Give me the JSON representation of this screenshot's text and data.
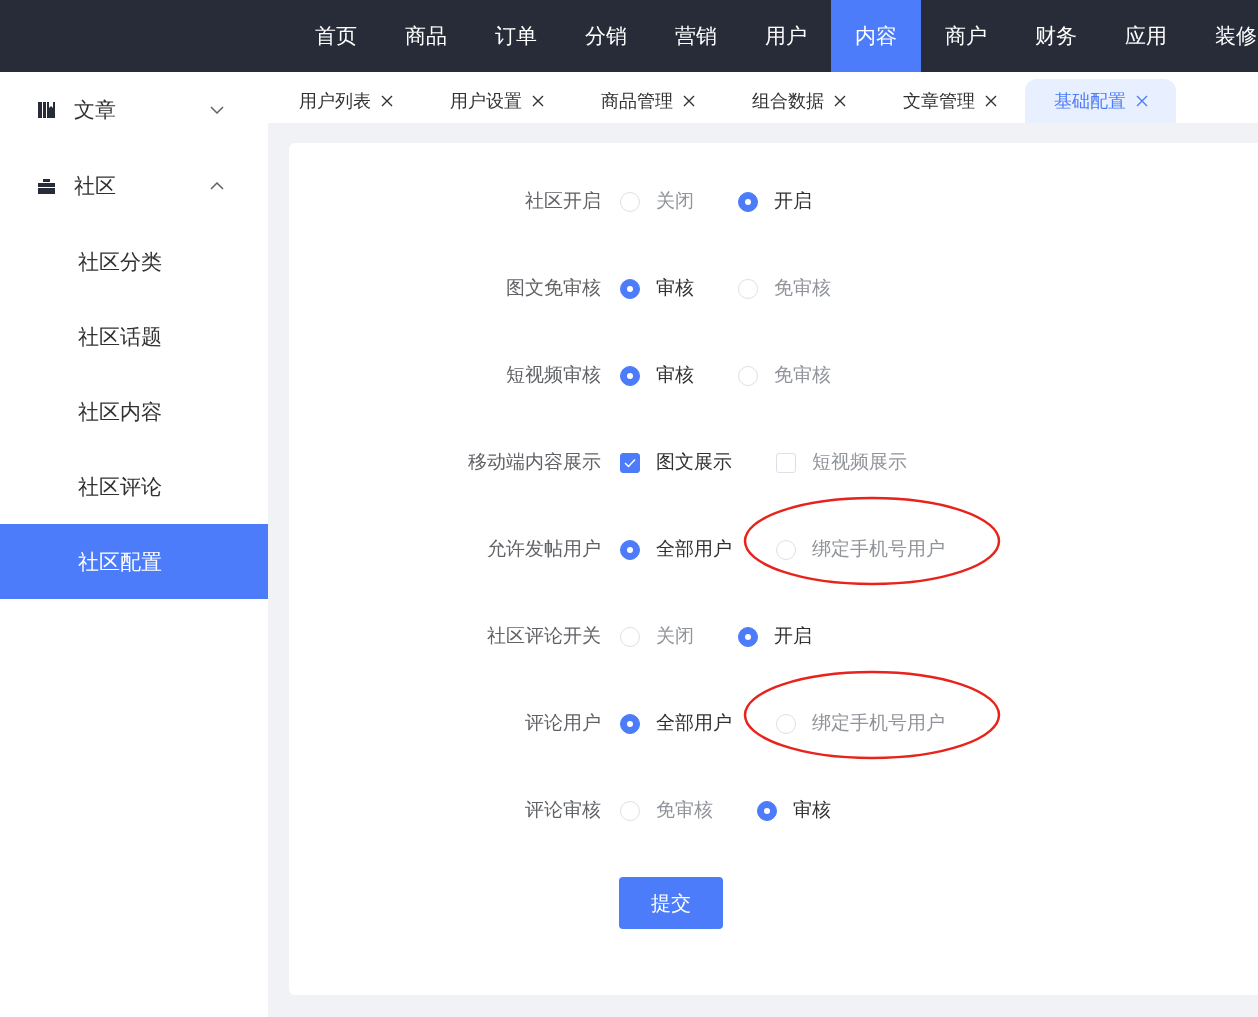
{
  "top_nav": [
    {
      "label": "首页",
      "selected": false
    },
    {
      "label": "商品",
      "selected": false
    },
    {
      "label": "订单",
      "selected": false
    },
    {
      "label": "分销",
      "selected": false
    },
    {
      "label": "营销",
      "selected": false
    },
    {
      "label": "用户",
      "selected": false
    },
    {
      "label": "内容",
      "selected": true
    },
    {
      "label": "商户",
      "selected": false
    },
    {
      "label": "财务",
      "selected": false
    },
    {
      "label": "应用",
      "selected": false
    },
    {
      "label": "装修",
      "selected": false
    }
  ],
  "sidebar": {
    "items": [
      {
        "label": "文章",
        "expanded": false
      },
      {
        "label": "社区",
        "expanded": true,
        "children": [
          {
            "label": "社区分类",
            "selected": false
          },
          {
            "label": "社区话题",
            "selected": false
          },
          {
            "label": "社区内容",
            "selected": false
          },
          {
            "label": "社区评论",
            "selected": false
          },
          {
            "label": "社区配置",
            "selected": true
          }
        ]
      }
    ]
  },
  "tabs": [
    {
      "label": "用户列表",
      "selected": false
    },
    {
      "label": "用户设置",
      "selected": false
    },
    {
      "label": "商品管理",
      "selected": false
    },
    {
      "label": "组合数据",
      "selected": false
    },
    {
      "label": "文章管理",
      "selected": false
    },
    {
      "label": "基础配置",
      "selected": true
    }
  ],
  "form": {
    "rows": [
      {
        "label": "社区开启",
        "kind": "radio",
        "options": [
          {
            "label": "关闭",
            "selected": false
          },
          {
            "label": "开启",
            "selected": true
          }
        ]
      },
      {
        "label": "图文免审核",
        "kind": "radio",
        "options": [
          {
            "label": "审核",
            "selected": true
          },
          {
            "label": "免审核",
            "selected": false
          }
        ]
      },
      {
        "label": "短视频审核",
        "kind": "radio",
        "options": [
          {
            "label": "审核",
            "selected": true
          },
          {
            "label": "免审核",
            "selected": false
          }
        ]
      },
      {
        "label": "移动端内容展示",
        "kind": "checkbox",
        "options": [
          {
            "label": "图文展示",
            "checked": true
          },
          {
            "label": "短视频展示",
            "checked": false
          }
        ]
      },
      {
        "label": "允许发帖用户",
        "kind": "radio",
        "options": [
          {
            "label": "全部用户",
            "selected": true
          },
          {
            "label": "绑定手机号用户",
            "selected": false,
            "circled": true
          }
        ]
      },
      {
        "label": "社区评论开关",
        "kind": "radio",
        "options": [
          {
            "label": "关闭",
            "selected": false
          },
          {
            "label": "开启",
            "selected": true
          }
        ]
      },
      {
        "label": "评论用户",
        "kind": "radio",
        "options": [
          {
            "label": "全部用户",
            "selected": true
          },
          {
            "label": "绑定手机号用户",
            "selected": false,
            "circled": true
          }
        ]
      },
      {
        "label": "评论审核",
        "kind": "radio",
        "options": [
          {
            "label": "免审核",
            "selected": false
          },
          {
            "label": "审核",
            "selected": true
          }
        ]
      }
    ],
    "submit": "提交"
  }
}
